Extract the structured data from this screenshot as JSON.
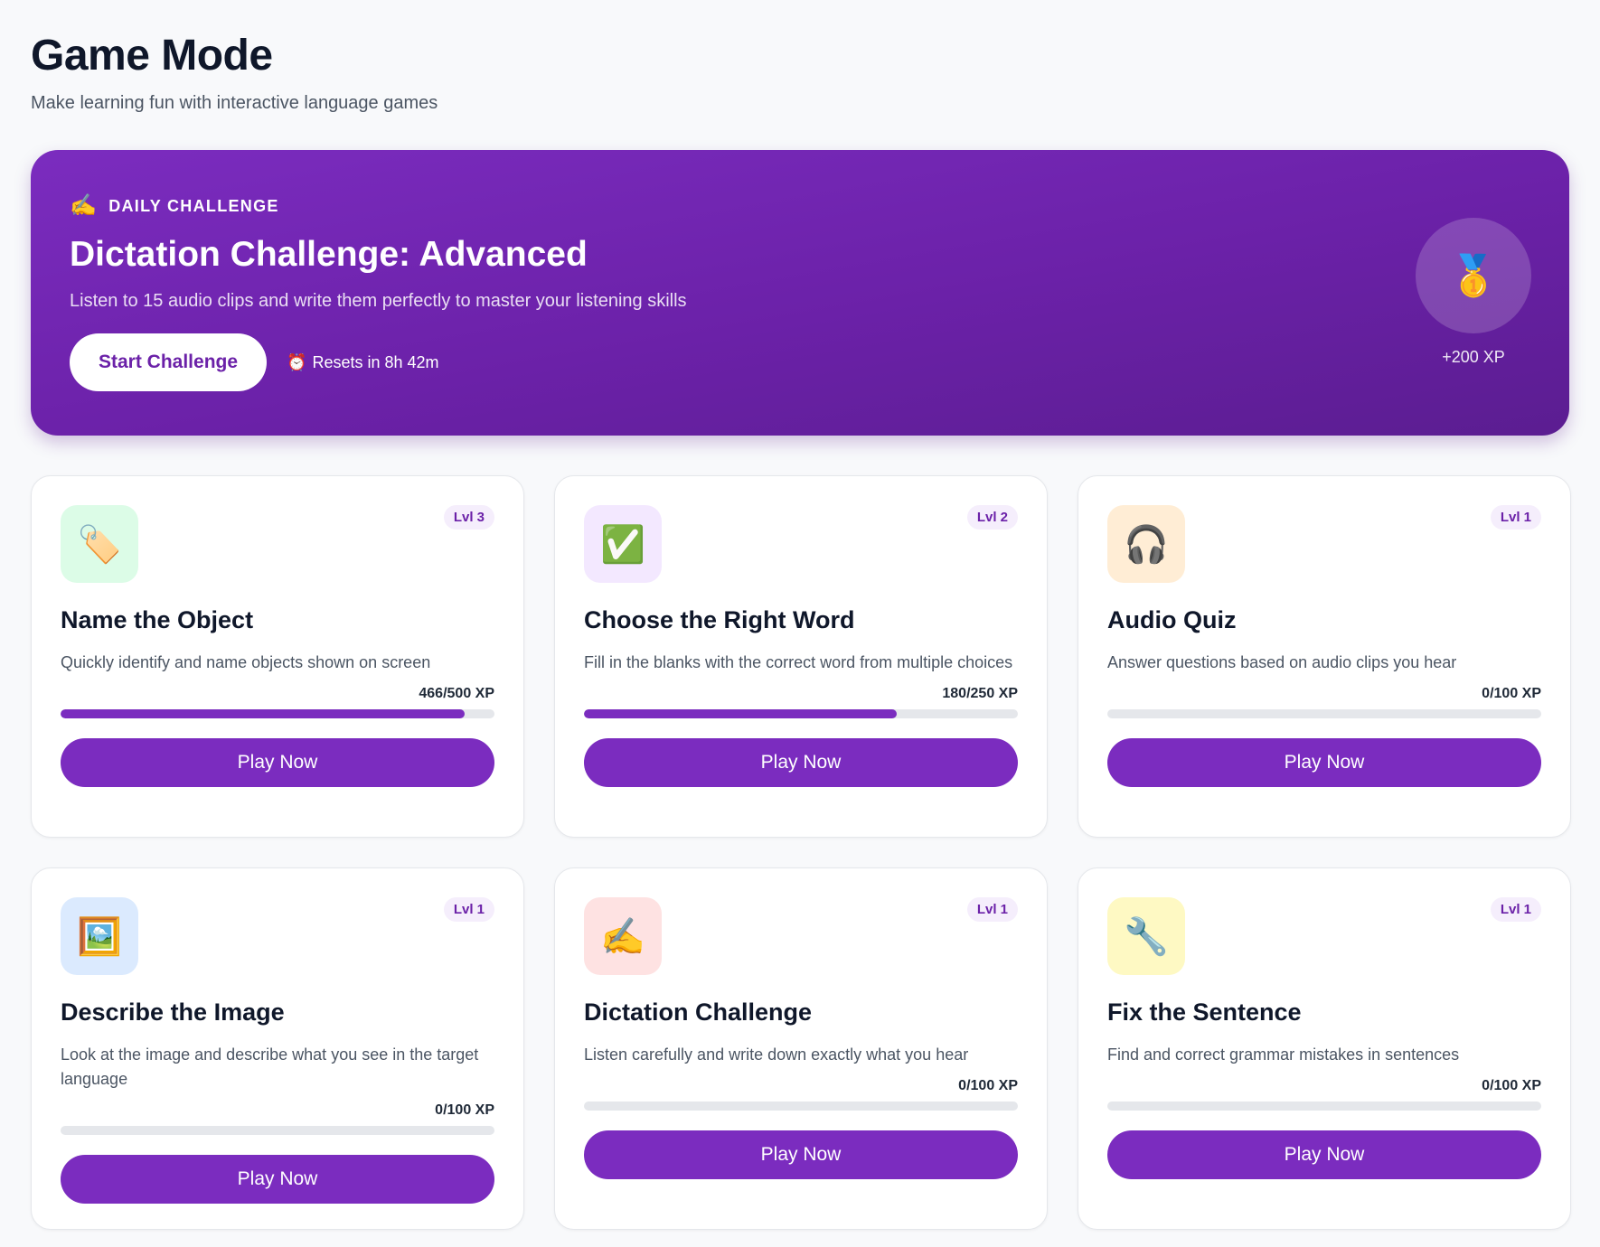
{
  "header": {
    "title": "Game Mode",
    "subtitle": "Make learning fun with interactive language games"
  },
  "daily_challenge": {
    "icon": "✍️",
    "eyebrow": "DAILY CHALLENGE",
    "title": "Dictation Challenge: Advanced",
    "description": "Listen to 15 audio clips and write them perfectly to master your listening skills",
    "start_label": "Start Challenge",
    "reset_icon": "⏰",
    "reset_text": "Resets in 8h 42m",
    "reward_icon": "🥇",
    "reward_xp": "+200 XP"
  },
  "play_label": "Play Now",
  "games": [
    {
      "icon": "🏷️",
      "icon_bg": "#dcfce7",
      "level": "Lvl 3",
      "title": "Name the Object",
      "description": "Quickly identify and name objects shown on screen",
      "xp": "466/500 XP",
      "progress": 0.932
    },
    {
      "icon": "✅",
      "icon_bg": "#f3e8ff",
      "level": "Lvl 2",
      "title": "Choose the Right Word",
      "description": "Fill in the blanks with the correct word from multiple choices",
      "xp": "180/250 XP",
      "progress": 0.72
    },
    {
      "icon": "🎧",
      "icon_bg": "#ffedd5",
      "level": "Lvl 1",
      "title": "Audio Quiz",
      "description": "Answer questions based on audio clips you hear",
      "xp": "0/100 XP",
      "progress": 0
    },
    {
      "icon": "🖼️",
      "icon_bg": "#dbeafe",
      "level": "Lvl 1",
      "title": "Describe the Image",
      "description": "Look at the image and describe what you see in the target language",
      "xp": "0/100 XP",
      "progress": 0
    },
    {
      "icon": "✍️",
      "icon_bg": "#fee2e2",
      "level": "Lvl 1",
      "title": "Dictation Challenge",
      "description": "Listen carefully and write down exactly what you hear",
      "xp": "0/100 XP",
      "progress": 0
    },
    {
      "icon": "🔧",
      "icon_bg": "#fef9c3",
      "level": "Lvl 1",
      "title": "Fix the Sentence",
      "description": "Find and correct grammar mistakes in sentences",
      "xp": "0/100 XP",
      "progress": 0
    }
  ]
}
